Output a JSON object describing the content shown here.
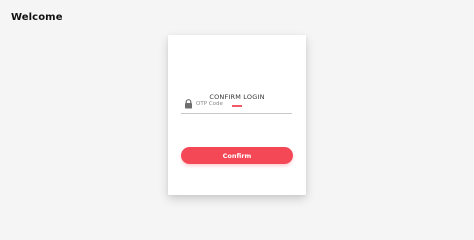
{
  "page": {
    "heading": "Welcome"
  },
  "login_card": {
    "title": "CONFIRM LOGIN",
    "otp_field": {
      "icon": "lock-icon",
      "placeholder": "OTP Code",
      "value": ""
    },
    "confirm_label": "Confirm"
  },
  "colors": {
    "accent": "#f44856",
    "page_background": "#f5f5f5",
    "card_background": "#ffffff"
  }
}
